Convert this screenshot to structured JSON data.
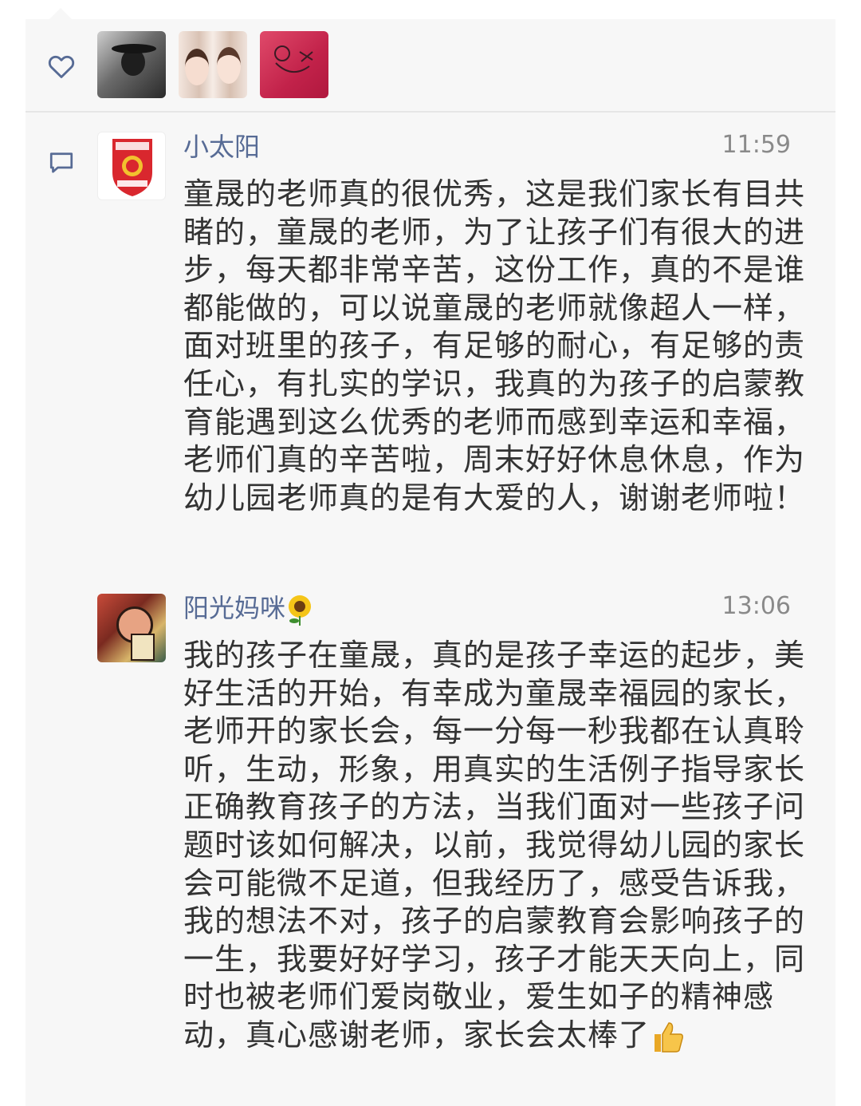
{
  "likes": {
    "icon": "heart-icon",
    "avatars": [
      "avatar-photo-hat",
      "avatar-photo-girls",
      "avatar-photo-pink"
    ]
  },
  "comments_icon": "comment-bubble-icon",
  "comments": [
    {
      "author": "小太阳",
      "time": "11:59",
      "text": "童晟的老师真的很优秀，这是我们家长有目共睹的，童晟的老师，为了让孩子们有很大的进步，每天都非常辛苦，这份工作，真的不是谁都能做的，可以说童晟的老师就像超人一样，面对班里的孩子，有足够的耐心，有足够的责任心，有扎实的学识，我真的为孩子的启蒙教育能遇到这么优秀的老师而感到幸运和幸福，老师们真的辛苦啦，周末好好休息休息，作为幼儿园老师真的是有大爱的人，谢谢老师啦！",
      "avatar": "school-badge-avatar"
    },
    {
      "author": "阳光妈咪",
      "author_emoji": "sunflower-emoji",
      "time": "13:06",
      "text": "我的孩子在童晟，真的是孩子幸运的起步，美好生活的开始，有幸成为童晟幸福园的家长，老师开的家长会，每一分每一秒我都在认真聆听，生动，形象，用真实的生活例子指导家长正确教育孩子的方法，当我们面对一些孩子问题时该如何解决，以前，我觉得幼儿园的家长会可能微不足道，但我经历了，感受告诉我，我的想法不对，孩子的启蒙教育会影响孩子的一生，我要好好学习，孩子才能天天向上，同时也被老师们爱岗敬业，爱生如子的精神感动，真心感谢老师，家长会太棒了",
      "text_emoji": "thumbs-up-emoji",
      "avatar": "new-year-art-avatar"
    }
  ],
  "colors": {
    "panel_bg": "#f7f7f7",
    "name_color": "#576b95",
    "text_color": "#333333",
    "time_color": "#8a8a8a"
  }
}
